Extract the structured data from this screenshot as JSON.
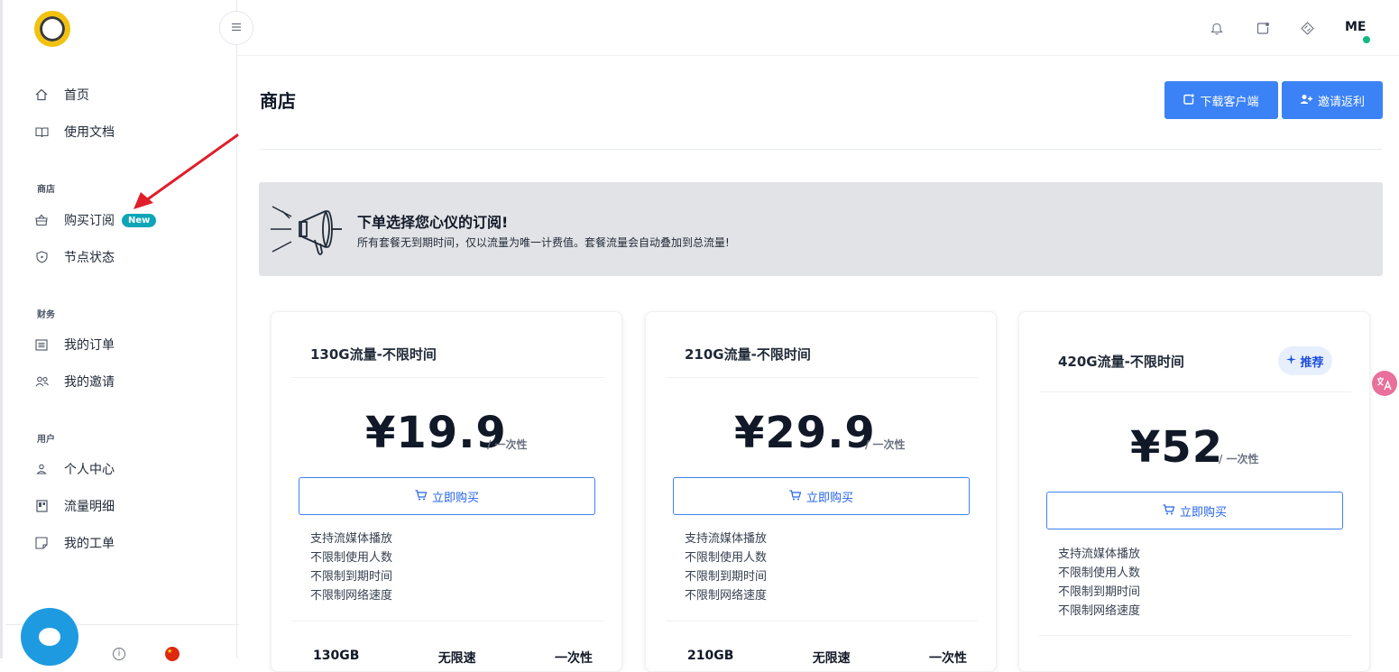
{
  "sidebar": {
    "nav_top": [
      {
        "label": "首页",
        "icon": "home-icon"
      },
      {
        "label": "使用文档",
        "icon": "book-icon"
      }
    ],
    "sections": [
      {
        "title": "商店",
        "items": [
          {
            "label": "购买订阅",
            "icon": "basket-icon",
            "badge": "New"
          },
          {
            "label": "节点状态",
            "icon": "shield-icon"
          }
        ]
      },
      {
        "title": "财务",
        "items": [
          {
            "label": "我的订单",
            "icon": "list-icon"
          },
          {
            "label": "我的邀请",
            "icon": "users-icon"
          }
        ]
      },
      {
        "title": "用户",
        "items": [
          {
            "label": "个人中心",
            "icon": "user-icon"
          },
          {
            "label": "流量明细",
            "icon": "chart-icon"
          },
          {
            "label": "我的工单",
            "icon": "ticket-icon"
          }
        ]
      }
    ],
    "footer_info": "i",
    "footer_flag": "★"
  },
  "topbar": {
    "avatar": "ME"
  },
  "page": {
    "title": "商店",
    "download_button": "下载客户端",
    "invite_button": "邀请返利"
  },
  "banner": {
    "title": "下单选择您心仪的订阅!",
    "subtitle": "所有套餐无到期时间，仅以流量为唯一计费值。套餐流量会自动叠加到总流量!"
  },
  "plans": [
    {
      "name": "130G流量-不限时间",
      "price": "¥19.9",
      "unit": "/ 一次性",
      "buy": "立即购买",
      "features": [
        "支持流媒体播放",
        "不限制使用人数",
        "不限制到期时间",
        "不限制网络速度"
      ],
      "stats": [
        "130GB",
        "无限速",
        "一次性"
      ]
    },
    {
      "name": "210G流量-不限时间",
      "price": "¥29.9",
      "unit": "/ 一次性",
      "buy": "立即购买",
      "features": [
        "支持流媒体播放",
        "不限制使用人数",
        "不限制到期时间",
        "不限制网络速度"
      ],
      "stats": [
        "210GB",
        "无限速",
        "一次性"
      ]
    },
    {
      "name": "420G流量-不限时间",
      "price": "¥52",
      "unit": "/ 一次性",
      "buy": "立即购买",
      "recommend": "推荐",
      "features": [
        "支持流媒体播放",
        "不限制使用人数",
        "不限制到期时间",
        "不限制网络速度"
      ]
    }
  ],
  "colors": {
    "primary": "#3b82f6",
    "badge": "#0ea5b7",
    "status_online": "#10b981",
    "arrow": "#e11d2a"
  }
}
